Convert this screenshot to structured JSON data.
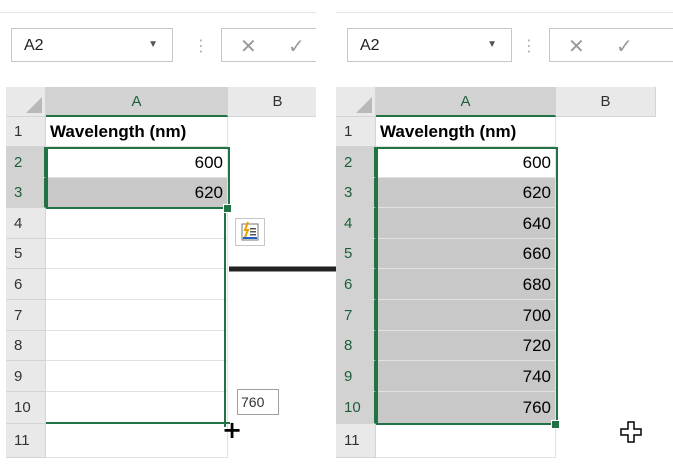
{
  "left": {
    "name_box": "A2",
    "columns": [
      "A",
      "B"
    ],
    "rows": [
      "1",
      "2",
      "3",
      "4",
      "5",
      "6",
      "7",
      "8",
      "9",
      "10",
      "11"
    ],
    "header_cell": "Wavelength (nm)",
    "values": [
      "600",
      "620"
    ],
    "autofill_tooltip": "760"
  },
  "right": {
    "name_box": "A2",
    "columns": [
      "A",
      "B"
    ],
    "rows": [
      "1",
      "2",
      "3",
      "4",
      "5",
      "6",
      "7",
      "8",
      "9",
      "10",
      "11"
    ],
    "header_cell": "Wavelength (nm)",
    "values": [
      "600",
      "620",
      "640",
      "660",
      "680",
      "700",
      "720",
      "740",
      "760"
    ]
  },
  "icons": {
    "namebox_dropdown": "▼",
    "formula_separator": "⋮",
    "cancel": "✕",
    "enter": "✓",
    "fill_crosshair": "+"
  }
}
